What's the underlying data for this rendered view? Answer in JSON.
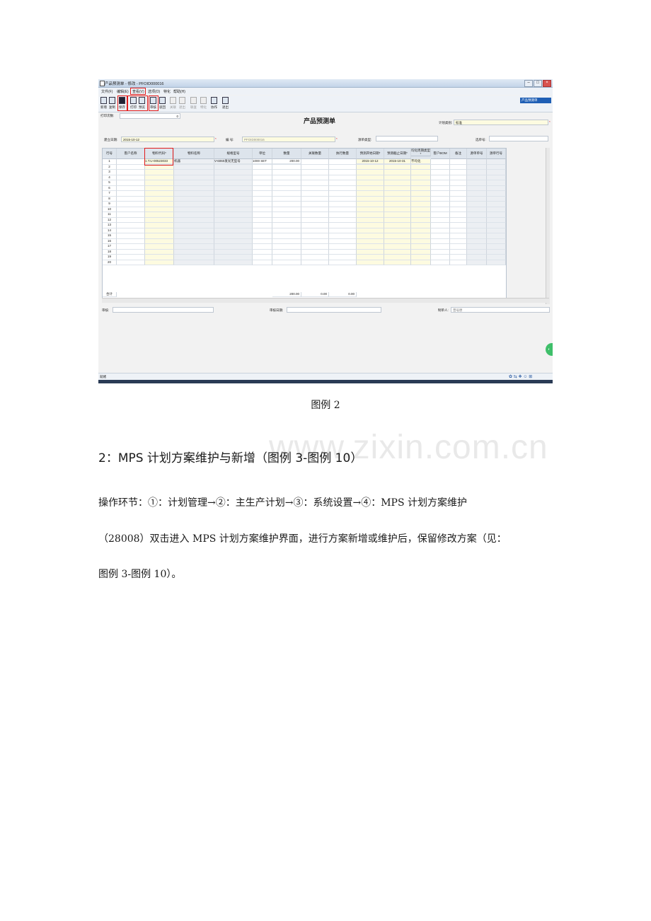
{
  "window": {
    "title": "产品预测单 - 修改 - PFOID000016",
    "combo_label": "产品预测单"
  },
  "menu": [
    "文件(F)",
    "编辑(E)",
    "查看(V)",
    "选项(O)",
    "特化",
    "帮助(H)"
  ],
  "toolbar": [
    {
      "label": "新增",
      "icon": "new-doc-icon",
      "enabled": true
    },
    {
      "label": "复制",
      "icon": "copy-icon",
      "enabled": true
    },
    {
      "label": "保存",
      "icon": "save-icon",
      "enabled": true
    },
    {
      "label": "打印",
      "icon": "print-icon",
      "enabled": true
    },
    {
      "label": "预览",
      "icon": "preview-icon",
      "enabled": true
    },
    {
      "label": "审核",
      "icon": "audit-icon",
      "enabled": true
    },
    {
      "label": "驳回",
      "icon": "reject-icon",
      "enabled": true
    },
    {
      "label": "关联",
      "icon": "link-icon",
      "enabled": false
    },
    {
      "label": "退出",
      "icon": "back-icon",
      "enabled": false
    },
    {
      "label": "联查",
      "icon": "query-icon",
      "enabled": false
    },
    {
      "label": "特化",
      "icon": "special-icon",
      "enabled": false
    },
    {
      "label": "协作",
      "icon": "collab-icon",
      "enabled": true
    },
    {
      "label": "退出",
      "icon": "exit-icon",
      "enabled": true
    }
  ],
  "form": {
    "title": "产品预测单",
    "print_count_label": "打印次数:",
    "print_count_value": "0",
    "plan_type_label": "计划类别:",
    "plan_type_value": "标准",
    "create_date_label": "建立日期:",
    "create_date_value": "2015-10-12",
    "number_label": "编    号:",
    "number_value": "PFOID000016",
    "source_type_label": "源单类型:",
    "source_no_label": "选单号:",
    "auditor_label": "审核:",
    "audit_date_label": "审核日期:",
    "creator_label": "制单人:",
    "creator_value": "曾号原"
  },
  "grid": {
    "columns": [
      "行号",
      "客户名称",
      "物料代码*",
      "物料名称",
      "规格型号",
      "单位",
      "数量",
      "关联数量",
      "执行数量",
      "预测开始日期*",
      "预测截止日期*",
      "均化周期类型*",
      "客户BOM",
      "备注",
      "源单单号",
      "源单行号"
    ],
    "row_numbers": [
      "1",
      "2",
      "3",
      "4",
      "5",
      "6",
      "7",
      "8",
      "9",
      "10",
      "11",
      "12",
      "13",
      "14",
      "15",
      "16",
      "17",
      "18",
      "19",
      "20"
    ],
    "first_row": [
      "1",
      "",
      "1.T.U-00523033",
      "机器",
      "V-6060发光无型号",
      "1000 SET",
      "",
      "200.00",
      "",
      "",
      "2015-10-12",
      "2015-10-31",
      "不均化",
      "",
      "",
      "",
      ""
    ],
    "total_label": "合计",
    "totals": {
      "qty": "200.00",
      "linked": "0.00",
      "executed": "0.00"
    }
  },
  "status": {
    "left": "就绪"
  },
  "doc": {
    "caption": "图例 2",
    "watermark": "www.zixin.com.cn",
    "heading": "2：MPS 计划方案维护与新增（图例 3-图例 10）",
    "para_lines": [
      "操作环节：①：计划管理→②：主生产计划→③：系统设置→④：MPS 计划方案维护",
      "（28008）双击进入 MPS 计划方案维护界面，进行方案新增或维护后，保留修改方案（见：",
      "图例 3-图例 10）。"
    ]
  }
}
